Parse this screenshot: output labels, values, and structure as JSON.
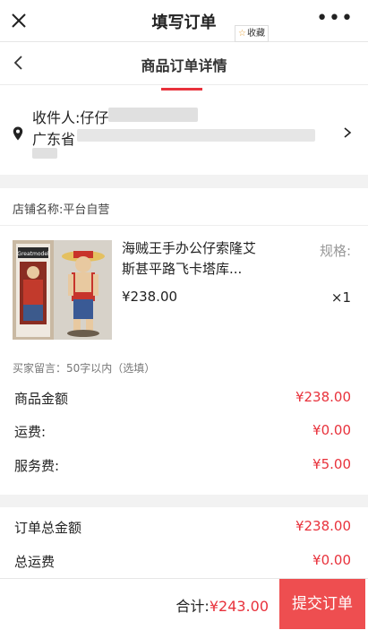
{
  "window": {
    "title": "填写订单",
    "favorite_label": "收藏"
  },
  "nav": {
    "title": "商品订单详情"
  },
  "address": {
    "recipient": "收件人:仔仔",
    "province": "广东省"
  },
  "shop": {
    "label": "店铺名称:平台自营"
  },
  "item": {
    "name": "海贼王手办公仔索隆艾斯甚平路飞卡塔库...",
    "spec_label": "规格:",
    "price": "¥238.00",
    "qty": "×1",
    "image_brand": "Greatmodel"
  },
  "buyer_note": {
    "placeholder": "买家留言：50字以内（选填）"
  },
  "summary": [
    {
      "label": "商品金额",
      "value": "¥238.00"
    },
    {
      "label": "运费:",
      "value": "¥0.00"
    },
    {
      "label": "服务费:",
      "value": "¥5.00"
    }
  ],
  "totals": [
    {
      "label": "订单总金额",
      "value": "¥238.00"
    },
    {
      "label": "总运费",
      "value": "¥0.00"
    }
  ],
  "footer": {
    "total_label": "合计:",
    "total_value": "¥243.00",
    "submit_label": "提交订单"
  },
  "colors": {
    "accent": "#e8323c",
    "submit_bg": "#ee4e50"
  }
}
